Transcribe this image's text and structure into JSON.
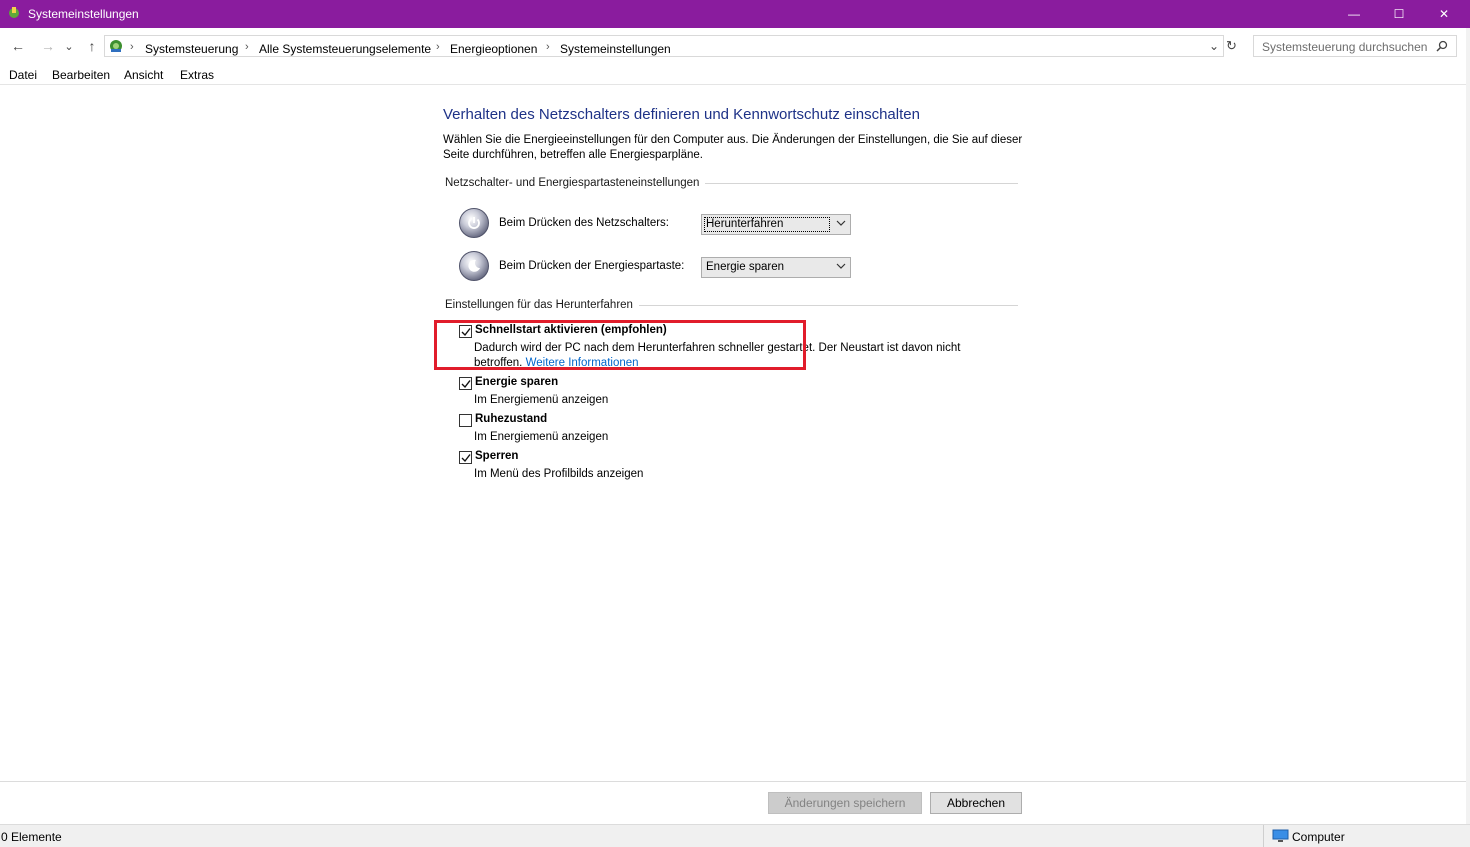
{
  "window": {
    "title": "Systemeinstellungen",
    "minimize_glyph": "—",
    "maximize_glyph": "☐",
    "close_glyph": "✕"
  },
  "nav": {
    "back_glyph": "←",
    "forward_glyph": "→",
    "recent_glyph": "⌄",
    "up_glyph": "↑",
    "breadcrumbs": [
      "Systemsteuerung",
      "Alle Systemsteuerungselemente",
      "Energieoptionen",
      "Systemeinstellungen"
    ],
    "refresh_glyph": "↻",
    "dropdown_glyph": "⌄",
    "search_placeholder": "Systemsteuerung durchsuchen"
  },
  "menu": {
    "items": [
      "Datei",
      "Bearbeiten",
      "Ansicht",
      "Extras"
    ]
  },
  "main": {
    "heading": "Verhalten des Netzschalters definieren und Kennwortschutz einschalten",
    "description": "Wählen Sie die Energieeinstellungen für den Computer aus. Die Änderungen der Einstellungen, die Sie auf dieser Seite durchführen, betreffen alle Energiesparpläne.",
    "button_group": {
      "label": "Netzschalter- und Energiespartasteneinstellungen",
      "power_button_label": "Beim Drücken des Netzschalters:",
      "power_button_value": "Herunterfahren",
      "sleep_button_label": "Beim Drücken der Energiespartaste:",
      "sleep_button_value": "Energie sparen"
    },
    "shutdown_group": {
      "label": "Einstellungen für das Herunterfahren",
      "options": [
        {
          "title": "Schnellstart aktivieren (empfohlen)",
          "checked": true,
          "desc": "Dadurch wird der PC nach dem Herunterfahren schneller gestartet. Der Neustart ist davon nicht betroffen.",
          "link": "Weitere Informationen"
        },
        {
          "title": "Energie sparen",
          "checked": true,
          "desc": "Im Energiemenü anzeigen"
        },
        {
          "title": "Ruhezustand",
          "checked": false,
          "desc": "Im Energiemenü anzeigen"
        },
        {
          "title": "Sperren",
          "checked": true,
          "desc": "Im Menü des Profilbilds anzeigen"
        }
      ]
    },
    "highlight_color": "#e11d2b",
    "heading_color": "#1e3287",
    "titlebar_color": "#8a1c9e"
  },
  "footer": {
    "save_label": "Änderungen speichern",
    "cancel_label": "Abbrechen"
  },
  "status": {
    "items_count": "0 Elemente",
    "location": "Computer"
  }
}
